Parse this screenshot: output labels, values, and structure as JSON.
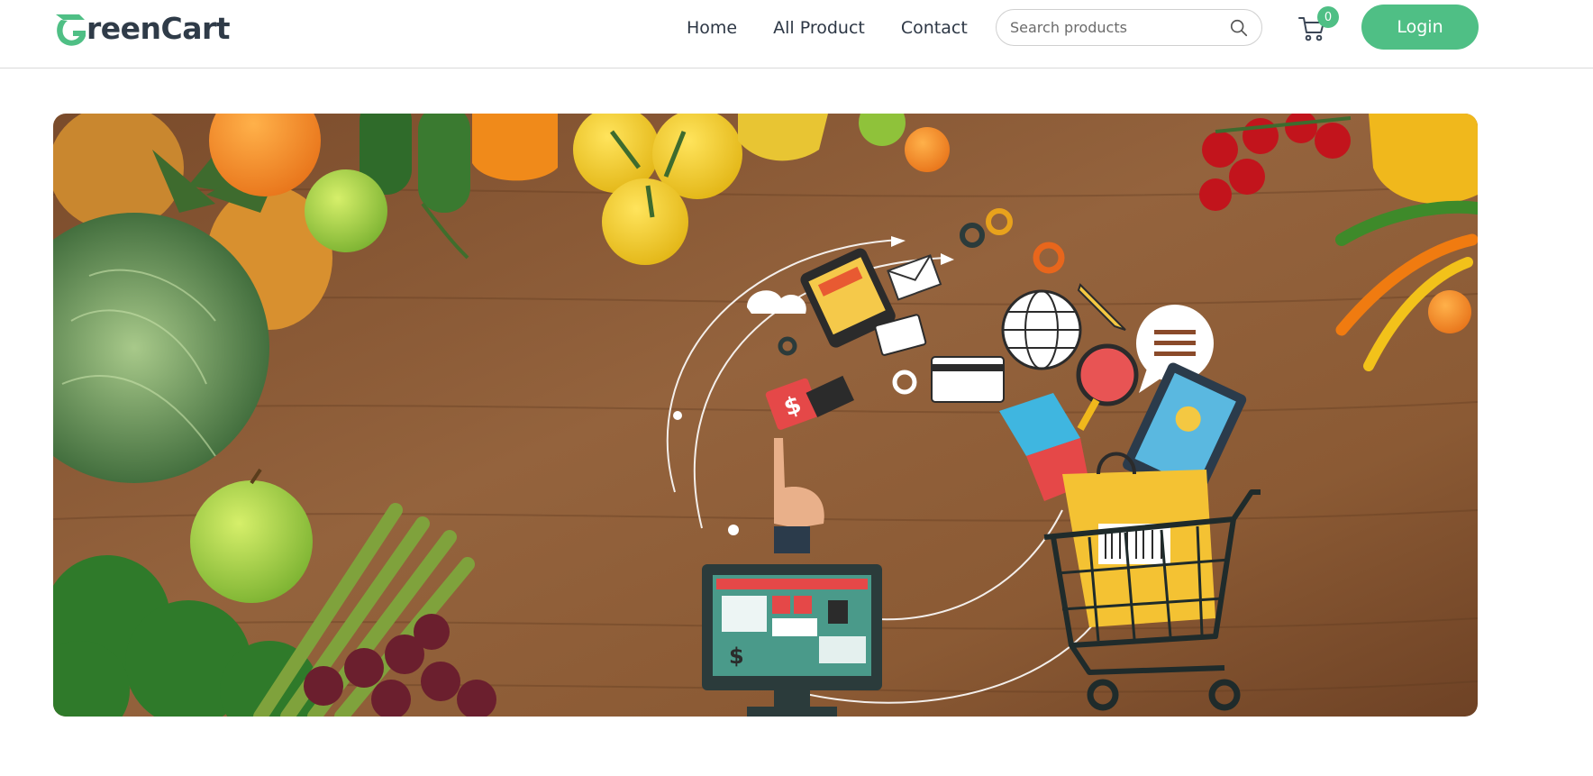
{
  "brand": {
    "name_rest": "reenCart",
    "accent": "#4fbf85",
    "text_color": "#2f3b48"
  },
  "nav": {
    "links": [
      {
        "label": "Home"
      },
      {
        "label": "All Product"
      },
      {
        "label": "Contact"
      }
    ]
  },
  "search": {
    "placeholder": "Search products",
    "icon": "search-icon"
  },
  "cart": {
    "count": "0",
    "icon": "shopping-cart-icon"
  },
  "login": {
    "label": "Login"
  },
  "hero": {
    "description": "",
    "background": "#8a5a35"
  }
}
